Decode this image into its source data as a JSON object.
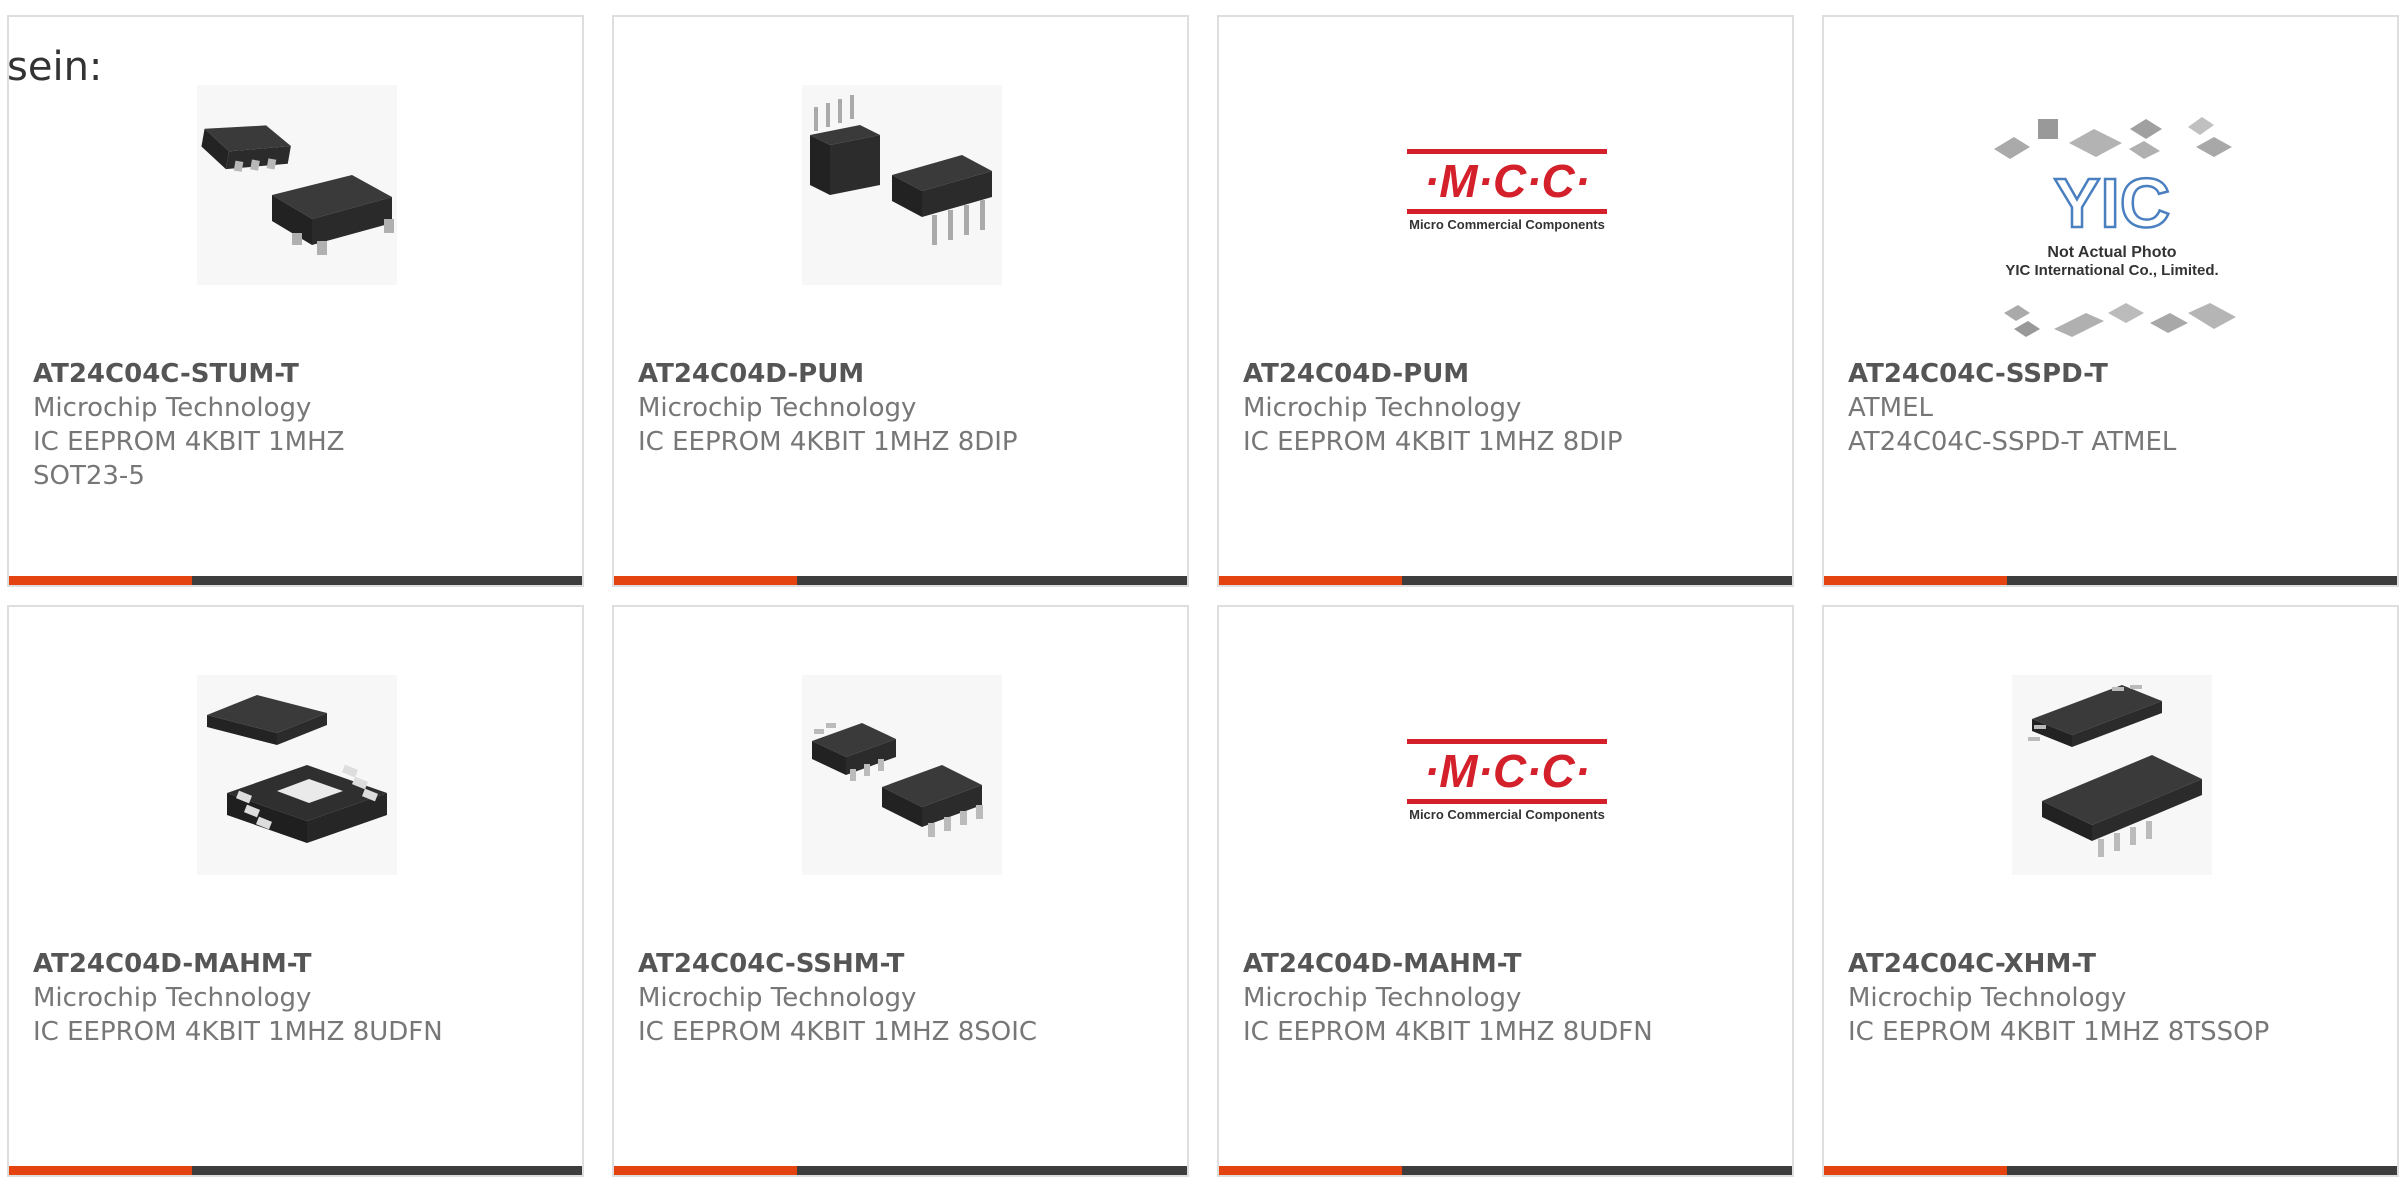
{
  "heading": "sein:",
  "products": [
    {
      "part": "AT24C04C-STUM-T",
      "maker": "Microchip Technology",
      "desc": "IC EEPROM 4KBIT 1MHZ SOT23-5",
      "image": "sot23-5-chip"
    },
    {
      "part": "AT24C04D-PUM",
      "maker": "Microchip Technology",
      "desc": "IC EEPROM 4KBIT 1MHZ 8DIP",
      "image": "dip8-chip"
    },
    {
      "part": "AT24C04D-PUM",
      "maker": "Microchip Technology",
      "desc": "IC EEPROM 4KBIT 1MHZ 8DIP",
      "image": "mcc-logo"
    },
    {
      "part": "AT24C04C-SSPD-T",
      "maker": "ATMEL",
      "desc": "AT24C04C-SSPD-T ATMEL",
      "image": "yic-placeholder"
    },
    {
      "part": "AT24C04D-MAHM-T",
      "maker": "Microchip Technology",
      "desc": "IC EEPROM 4KBIT 1MHZ 8UDFN",
      "image": "udfn8-chip"
    },
    {
      "part": "AT24C04C-SSHM-T",
      "maker": "Microchip Technology",
      "desc": "IC EEPROM 4KBIT 1MHZ 8SOIC",
      "image": "soic8-chip"
    },
    {
      "part": "AT24C04D-MAHM-T",
      "maker": "Microchip Technology",
      "desc": "IC EEPROM 4KBIT 1MHZ 8UDFN",
      "image": "mcc-logo"
    },
    {
      "part": "AT24C04C-XHM-T",
      "maker": "Microchip Technology",
      "desc": "IC EEPROM 4KBIT 1MHZ 8TSSOP",
      "image": "tssop8-chip"
    }
  ],
  "mcc_logo": {
    "mark": "·M·C·C·",
    "subtitle": "Micro Commercial Components"
  },
  "yic_logo": {
    "mark": "YIC",
    "line1": "Not Actual Photo",
    "line2": "YIC International Co., Limited."
  },
  "colors": {
    "accent": "#e4420f",
    "bar": "#3d3d3d",
    "border": "#dedede",
    "mcc_red": "#d4202a"
  }
}
